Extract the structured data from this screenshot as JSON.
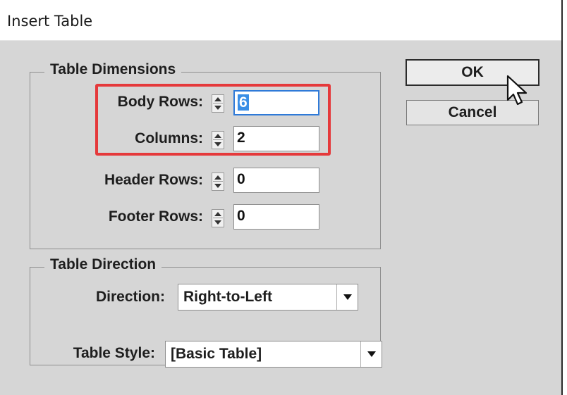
{
  "window": {
    "title": "Insert Table"
  },
  "dimensions": {
    "group_label": "Table Dimensions",
    "body_rows": {
      "label": "Body Rows:",
      "value": "6"
    },
    "columns": {
      "label": "Columns:",
      "value": "2"
    },
    "header_rows": {
      "label": "Header Rows:",
      "value": "0"
    },
    "footer_rows": {
      "label": "Footer Rows:",
      "value": "0"
    }
  },
  "direction": {
    "group_label": "Table Direction",
    "label": "Direction:",
    "value": "Right-to-Left"
  },
  "style": {
    "label": "Table Style:",
    "value": "[Basic Table]"
  },
  "buttons": {
    "ok": "OK",
    "cancel": "Cancel"
  },
  "icons": {
    "spinner": "spinner-arrows-icon",
    "dropdown": "dropdown-arrow-icon",
    "cursor": "mouse-pointer-icon"
  },
  "colors": {
    "dialog_bg": "#d6d6d6",
    "highlight": "#e5393b",
    "focus": "#2f7ad8",
    "selection": "#3a8ee6"
  }
}
